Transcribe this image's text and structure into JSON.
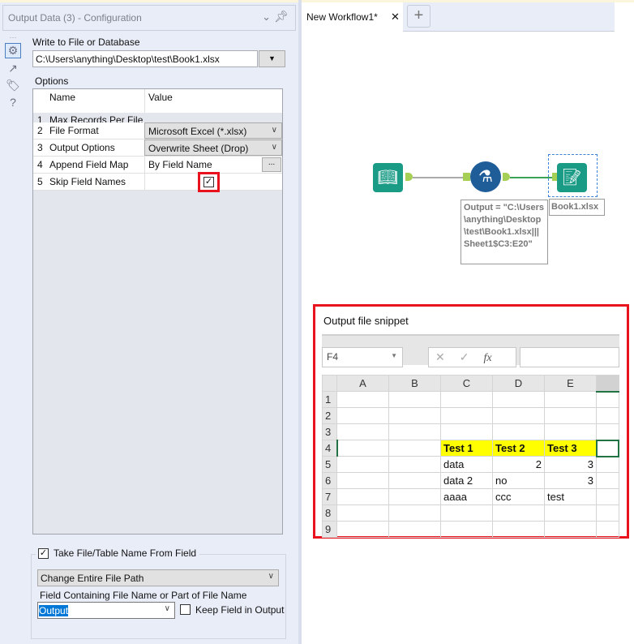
{
  "panel": {
    "title": "Output Data (3) - Configuration",
    "write_label": "Write to File or Database",
    "path": "C:\\Users\\anything\\Desktop\\test\\Book1.xlsx",
    "options_label": "Options",
    "columns": [
      "Name",
      "Value"
    ],
    "options": [
      {
        "num": "1",
        "name": "Max Records Per File",
        "value": ""
      },
      {
        "num": "2",
        "name": "File Format",
        "value": "Microsoft Excel (*.xlsx)"
      },
      {
        "num": "3",
        "name": "Output Options",
        "value": "Overwrite Sheet (Drop)"
      },
      {
        "num": "4",
        "name": "Append Field Map",
        "value": "By Field Name",
        "button": "..."
      },
      {
        "num": "5",
        "name": "Skip Field Names",
        "checked": true
      }
    ],
    "take_name_label": "Take File/Table Name From Field",
    "take_name_checked": true,
    "mode": "Change Entire File Path",
    "field_label": "Field Containing File Name or Part of File Name",
    "field": "Output",
    "keep_label": "Keep Field in Output",
    "keep_checked": false
  },
  "tabs": {
    "active": "New Workflow1*",
    "add": "+"
  },
  "workflow": {
    "annotation": "Output = \"C:\\Users\\anything\\Desktop\\test\\Book1.xlsx|||Sheet1$C3:E20\"",
    "output_label": "Book1.xlsx"
  },
  "snippet": {
    "title": "Output file snippet",
    "cell_ref": "F4",
    "fx": "fx",
    "columns": [
      "A",
      "B",
      "C",
      "D",
      "E",
      ""
    ],
    "rows": [
      [
        "1",
        "",
        "",
        "",
        "",
        "",
        ""
      ],
      [
        "2",
        "",
        "",
        "",
        "",
        "",
        ""
      ],
      [
        "3",
        "",
        "",
        "",
        "",
        "",
        ""
      ],
      [
        "4",
        "",
        "",
        "Test 1",
        "Test 2",
        "Test 3",
        ""
      ],
      [
        "5",
        "",
        "",
        "data",
        "2",
        "3",
        ""
      ],
      [
        "6",
        "",
        "",
        "data 2",
        "no",
        "3",
        ""
      ],
      [
        "7",
        "",
        "",
        "aaaa",
        "ccc",
        "test",
        ""
      ],
      [
        "8",
        "",
        "",
        "",
        "",
        "",
        ""
      ],
      [
        "9",
        "",
        "",
        "",
        "",
        "",
        ""
      ]
    ]
  },
  "colors": {
    "highlight": "#e8131d",
    "header_fill": "#ffff00",
    "tool_teal": "#1a9b86",
    "tool_blue": "#1f5d99"
  }
}
